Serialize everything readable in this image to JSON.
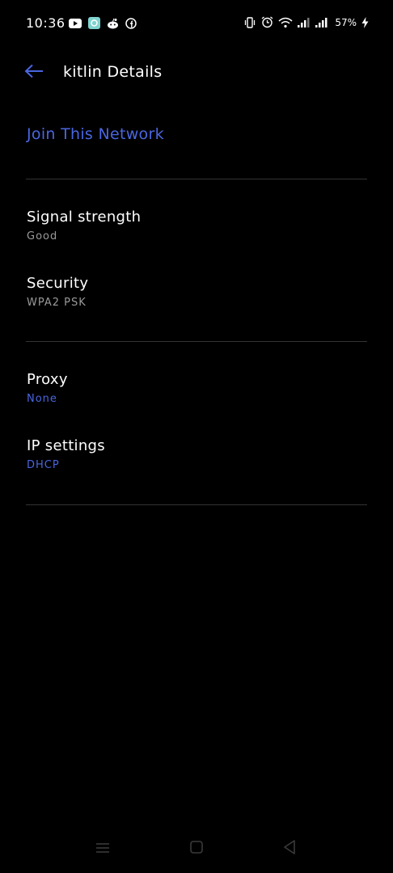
{
  "status_bar": {
    "time": "10:36",
    "battery": "57%",
    "notification_icons": [
      "youtube-icon",
      "app-icon",
      "reddit-icon",
      "facebook-icon"
    ],
    "system_icons": [
      "vibrate-icon",
      "alarm-icon",
      "wifi-icon",
      "signal-icon",
      "signal-icon",
      "charging-icon"
    ]
  },
  "header": {
    "title": "kitlin Details"
  },
  "join_network": {
    "label": "Join This Network"
  },
  "details": {
    "signal": {
      "title": "Signal strength",
      "value": "Good"
    },
    "security": {
      "title": "Security",
      "value": "WPA2 PSK"
    }
  },
  "advanced": {
    "proxy": {
      "title": "Proxy",
      "value": "None"
    },
    "ip_settings": {
      "title": "IP settings",
      "value": "DHCP"
    }
  },
  "colors": {
    "accent": "#4a66e0",
    "background": "#000000",
    "secondary_text": "#9a9a9a",
    "divider": "#333333"
  },
  "nav_bar": {
    "icons": [
      "menu-icon",
      "home-icon",
      "back-triangle-icon"
    ]
  }
}
